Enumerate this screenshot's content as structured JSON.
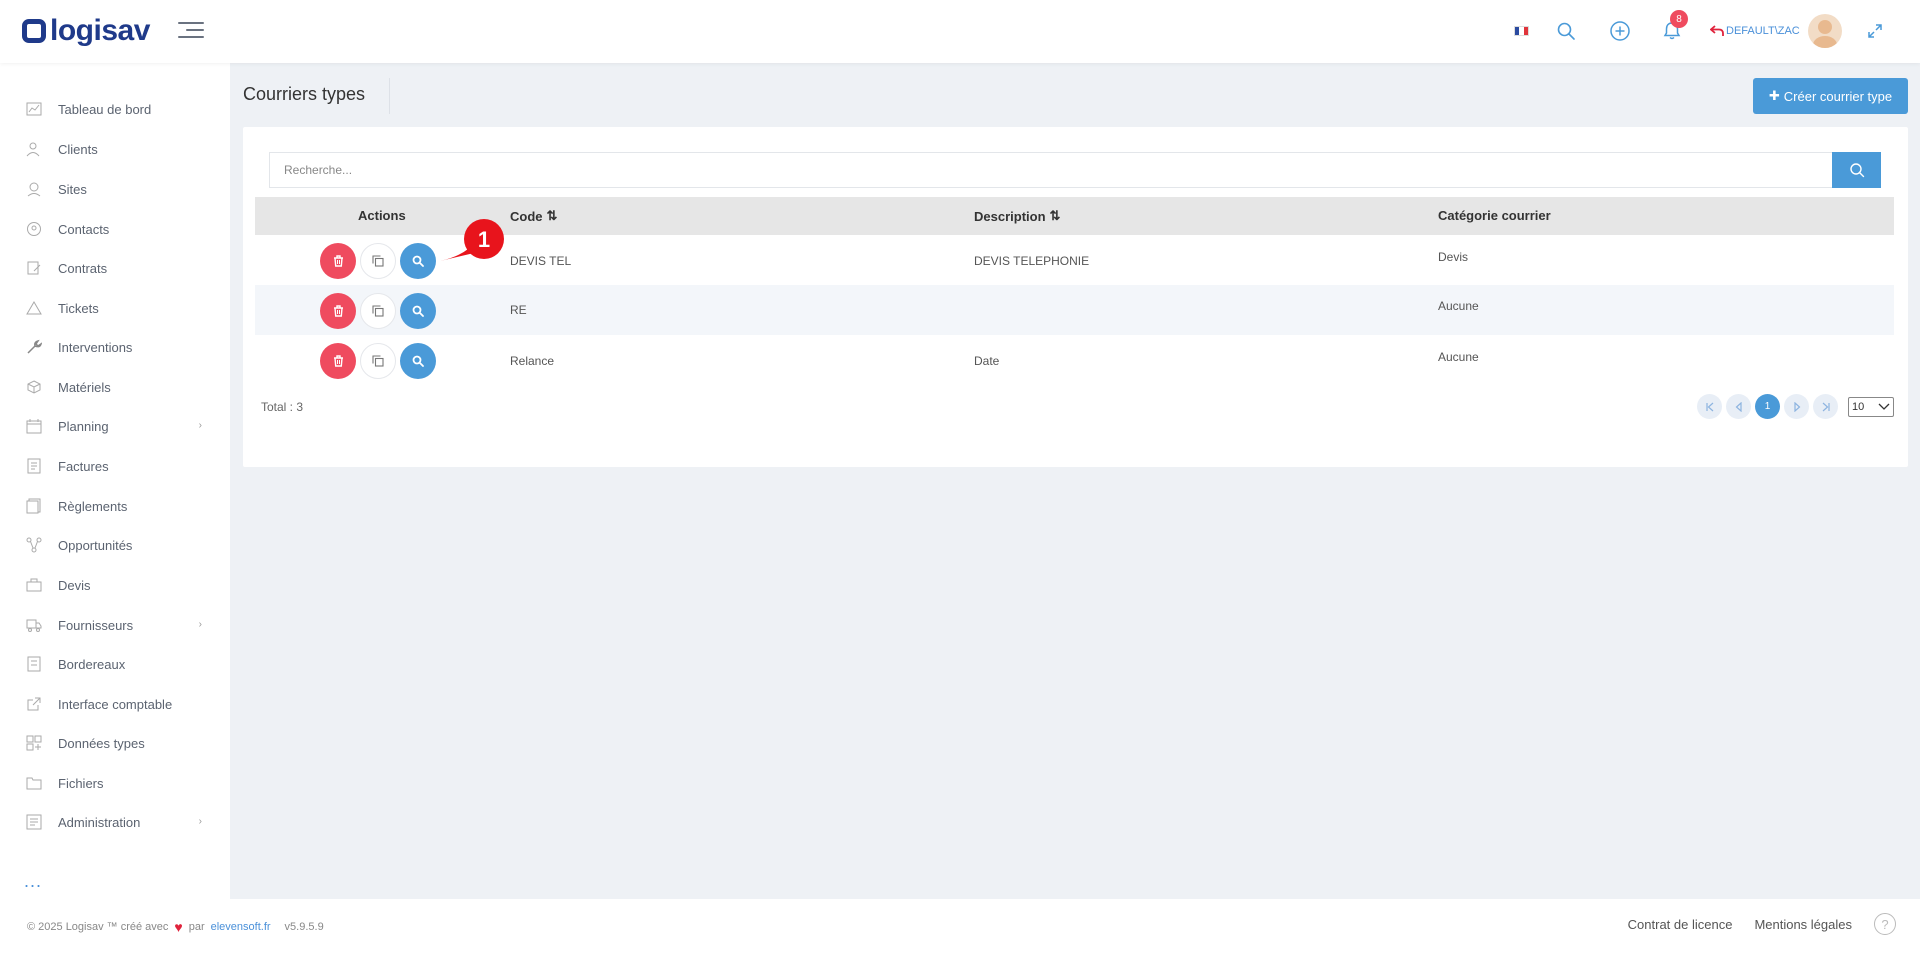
{
  "header": {
    "brand": "logisav",
    "notification_count": "8",
    "user_name": "DEFAULT\\ZAC",
    "flag_colors": [
      "#2b4ba0",
      "#ffffff",
      "#e0343b"
    ]
  },
  "sidebar": {
    "items": [
      {
        "label": "Tableau de bord",
        "icon": "dashboard-icon"
      },
      {
        "label": "Clients",
        "icon": "users-icon"
      },
      {
        "label": "Sites",
        "icon": "location-pin-icon"
      },
      {
        "label": "Contacts",
        "icon": "contacts-icon"
      },
      {
        "label": "Contrats",
        "icon": "contract-icon"
      },
      {
        "label": "Tickets",
        "icon": "warning-icon"
      },
      {
        "label": "Interventions",
        "icon": "wrench-icon"
      },
      {
        "label": "Matériels",
        "icon": "box-icon"
      },
      {
        "label": "Planning",
        "icon": "calendar-icon"
      },
      {
        "label": "Factures",
        "icon": "invoice-icon"
      },
      {
        "label": "Règlements",
        "icon": "payments-icon"
      },
      {
        "label": "Opportunités",
        "icon": "network-icon"
      },
      {
        "label": "Devis",
        "icon": "briefcase-icon"
      },
      {
        "label": "Fournisseurs",
        "icon": "truck-icon"
      },
      {
        "label": "Bordereaux",
        "icon": "slips-icon"
      },
      {
        "label": "Interface comptable",
        "icon": "external-link-icon"
      },
      {
        "label": "Données types",
        "icon": "grid-icon"
      },
      {
        "label": "Fichiers",
        "icon": "folder-icon"
      },
      {
        "label": "Administration",
        "icon": "admin-icon"
      }
    ],
    "more": "..."
  },
  "main": {
    "title": "Courriers types",
    "create_button": "Créer courrier type",
    "search_placeholder": "Recherche...",
    "columns": {
      "actions": "Actions",
      "code": "Code",
      "description": "Description",
      "category": "Catégorie courrier"
    },
    "rows": [
      {
        "code": "DEVIS TEL",
        "description": "DEVIS TELEPHONIE",
        "category": "Devis"
      },
      {
        "code": "RE",
        "description": "",
        "category": "Aucune"
      },
      {
        "code": "Relance",
        "description": "Date",
        "category": "Aucune"
      }
    ],
    "callout_number": "1",
    "total": "Total : 3",
    "current_page": "1",
    "per_page": "10"
  },
  "footer": {
    "copyright": "© 2025 Logisav ™ créé avec",
    "by": "par",
    "link": "elevensoft.fr",
    "version": "v5.9.5.9",
    "license": "Contrat de licence",
    "legal": "Mentions légales",
    "help": "?"
  },
  "colors": {
    "accent": "#4a9ad8",
    "danger": "#ef4b5f",
    "brand": "#1f3a8a"
  }
}
